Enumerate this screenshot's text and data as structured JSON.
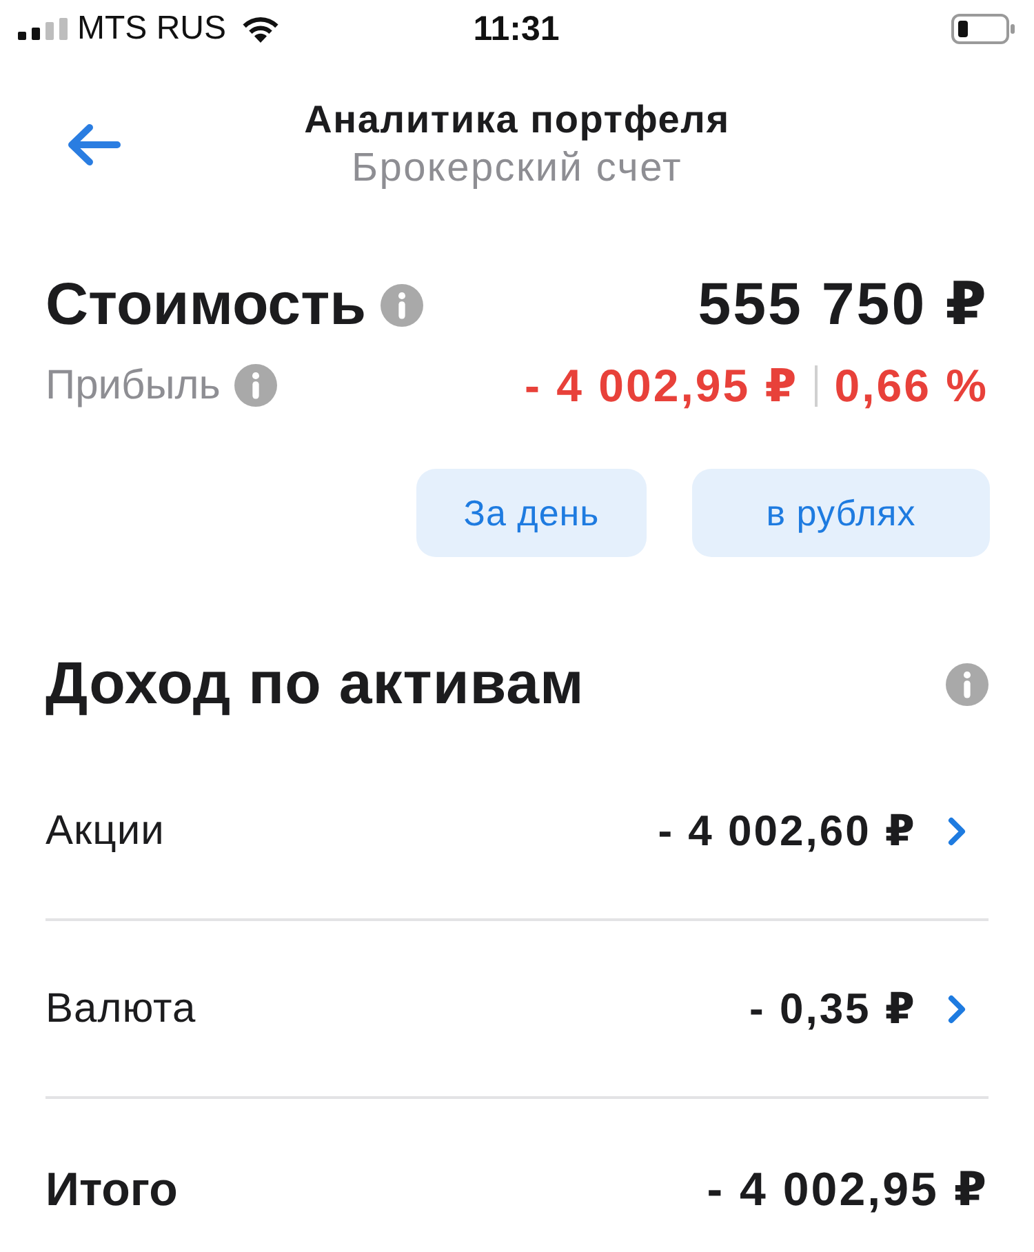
{
  "status_bar": {
    "carrier": "MTS RUS",
    "time": "11:31"
  },
  "header": {
    "title": "Аналитика портфеля",
    "subtitle": "Брокерский счет"
  },
  "summary": {
    "value_label": "Стоимость",
    "value": "555 750 ₽",
    "profit_label": "Прибыль",
    "profit_amount": "- 4 002,95 ₽",
    "profit_percent": "0,66 %",
    "negative": true
  },
  "filters": [
    {
      "label": "За день"
    },
    {
      "label": "в рублях"
    }
  ],
  "income": {
    "title": "Доход по активам",
    "rows": [
      {
        "label": "Акции",
        "value": "- 4 002,60 ₽"
      },
      {
        "label": "Валюта",
        "value": "- 0,35 ₽"
      }
    ],
    "total": {
      "label": "Итого",
      "value": "- 4 002,95 ₽"
    }
  }
}
